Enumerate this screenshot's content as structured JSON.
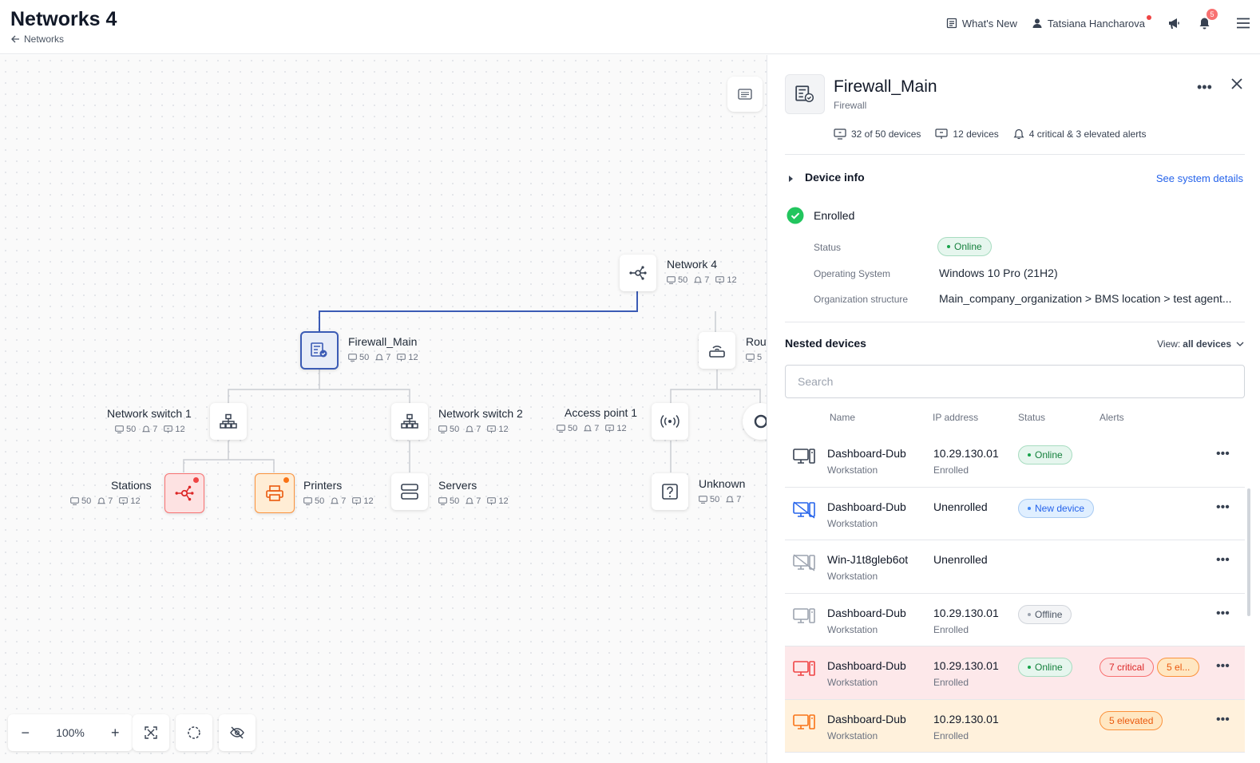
{
  "header": {
    "title": "Networks 4",
    "breadcrumb": "Networks",
    "whats_new": "What's New",
    "user_name": "Tatsiana Hancharova",
    "notifications_count": "5"
  },
  "canvas": {
    "nodes": [
      {
        "key": "network4",
        "label": "Network 4",
        "stats": [
          "50",
          "7",
          "12"
        ]
      },
      {
        "key": "firewall",
        "label": "Firewall_Main",
        "stats": [
          "50",
          "7",
          "12"
        ]
      },
      {
        "key": "router",
        "label": "Rou",
        "stats": [
          "5"
        ]
      },
      {
        "key": "switch1",
        "label": "Network switch 1",
        "stats": [
          "50",
          "7",
          "12"
        ]
      },
      {
        "key": "switch2",
        "label": "Network switch 2",
        "stats": [
          "50",
          "7",
          "12"
        ]
      },
      {
        "key": "ap1",
        "label": "Access point 1",
        "stats": [
          "50",
          "7",
          "12"
        ]
      },
      {
        "key": "stations",
        "label": "Stations",
        "stats": [
          "50",
          "7",
          "12"
        ]
      },
      {
        "key": "printers",
        "label": "Printers",
        "stats": [
          "50",
          "7",
          "12"
        ]
      },
      {
        "key": "servers",
        "label": "Servers",
        "stats": [
          "50",
          "7",
          "12"
        ]
      },
      {
        "key": "unknown",
        "label": "Unknown",
        "stats": [
          "50",
          "7"
        ]
      }
    ],
    "zoom_level": "100%"
  },
  "panel": {
    "title": "Firewall_Main",
    "subtitle": "Firewall",
    "stats": {
      "devices": "32 of 50 devices",
      "monitored": "12 devices",
      "alerts": "4 critical & 3 elevated alerts"
    },
    "device_info_label": "Device info",
    "see_details": "See system details",
    "enrolled_label": "Enrolled",
    "status_label": "Status",
    "status_value": "Online",
    "os_label": "Operating System",
    "os_value": "Windows 10 Pro (21H2)",
    "org_label": "Organization structure",
    "org_value": "Main_company_organization > BMS location > test agent...",
    "nested_title": "Nested devices",
    "view_label": "View:",
    "view_value": "all devices",
    "search_placeholder": "Search",
    "columns": [
      "Name",
      "IP address",
      "Status",
      "Alerts"
    ],
    "rows": [
      {
        "name": "Dashboard-Dub",
        "type": "Workstation",
        "ip": "10.29.130.01",
        "enroll": "Enrolled",
        "status": "Online",
        "alerts": []
      },
      {
        "name": "Dashboard-Dub",
        "type": "Workstation",
        "ip": "Unenrolled",
        "enroll": "",
        "status": "New device",
        "alerts": []
      },
      {
        "name": "Win-J1t8gleb6ot",
        "type": "Workstation",
        "ip": "Unenrolled",
        "enroll": "",
        "status": "",
        "alerts": []
      },
      {
        "name": "Dashboard-Dub",
        "type": "Workstation",
        "ip": "10.29.130.01",
        "enroll": "Enrolled",
        "status": "Offline",
        "alerts": []
      },
      {
        "name": "Dashboard-Dub",
        "type": "Workstation",
        "ip": "10.29.130.01",
        "enroll": "Enrolled",
        "status": "Online",
        "alerts": [
          "7 critical",
          "5 el..."
        ]
      },
      {
        "name": "Dashboard-Dub",
        "type": "Workstation",
        "ip": "10.29.130.01",
        "enroll": "Enrolled",
        "status": "",
        "alerts": [
          "5 elevated"
        ]
      }
    ]
  },
  "colors": {
    "accent": "#2563eb",
    "selected_node": "#3b5bb5",
    "critical": "#dc2626",
    "elevated": "#ea580c",
    "online": "#16a34a"
  }
}
